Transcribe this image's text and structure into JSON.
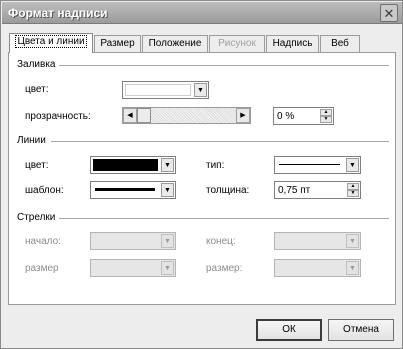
{
  "window": {
    "title": "Формат надписи",
    "close_icon": "close-icon"
  },
  "tabs": [
    {
      "label": "Цвета и линии",
      "active": true,
      "disabled": false
    },
    {
      "label": "Размер",
      "active": false,
      "disabled": false
    },
    {
      "label": "Положение",
      "active": false,
      "disabled": false
    },
    {
      "label": "Рисунок",
      "active": false,
      "disabled": true
    },
    {
      "label": "Надпись",
      "active": false,
      "disabled": false
    },
    {
      "label": "Веб",
      "active": false,
      "disabled": false
    }
  ],
  "fill": {
    "group_title": "Заливка",
    "color_label": "цвет:",
    "color_value": "#ffffff",
    "transparency_label": "прозрачность:",
    "transparency_value": "0 %",
    "transparency_fraction": 0
  },
  "lines": {
    "group_title": "Линии",
    "color_label": "цвет:",
    "color_value": "#000000",
    "type_label": "тип:",
    "pattern_label": "шаблон:",
    "thickness_label": "толщина:",
    "thickness_value": "0,75 пт"
  },
  "arrows": {
    "group_title": "Стрелки",
    "begin_label": "начало:",
    "end_label": "конец:",
    "size_label_left": "размер",
    "size_label_right": "размер:"
  },
  "buttons": {
    "ok": "ОК",
    "cancel": "Отмена"
  }
}
